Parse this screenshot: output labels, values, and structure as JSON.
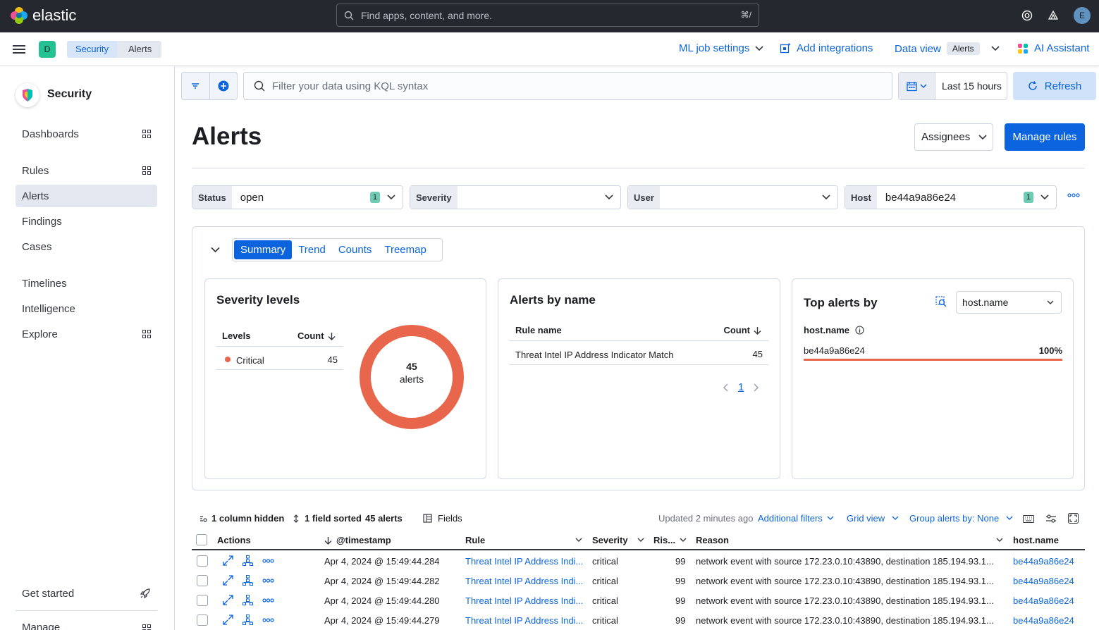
{
  "header": {
    "app_name": "elastic",
    "search_placeholder": "Find apps, content, and more.",
    "search_shortcut": "⌘/",
    "user_initial": "E"
  },
  "subheader": {
    "space_initial": "D",
    "breadcrumbs": [
      "Security",
      "Alerts"
    ],
    "ml_job_settings": "ML job settings",
    "add_integrations": "Add integrations",
    "data_view_label": "Data view",
    "data_view_value": "Alerts",
    "ai_assistant": "AI Assistant"
  },
  "sidebar": {
    "title": "Security",
    "items": [
      {
        "label": "Dashboards"
      },
      {
        "label": "Rules"
      },
      {
        "label": "Alerts"
      },
      {
        "label": "Findings"
      },
      {
        "label": "Cases"
      },
      {
        "label": "Timelines"
      },
      {
        "label": "Intelligence"
      },
      {
        "label": "Explore"
      }
    ],
    "get_started": "Get started",
    "manage": "Manage"
  },
  "querybar": {
    "placeholder": "Filter your data using KQL syntax",
    "time_range": "Last 15 hours",
    "refresh": "Refresh"
  },
  "page": {
    "title": "Alerts",
    "assignees": "Assignees",
    "manage_rules": "Manage rules"
  },
  "filters": [
    {
      "label": "Status",
      "value": "open",
      "count": "1"
    },
    {
      "label": "Severity",
      "value": "",
      "count": ""
    },
    {
      "label": "User",
      "value": "",
      "count": ""
    },
    {
      "label": "Host",
      "value": "be44a9a86e24",
      "count": "1"
    }
  ],
  "summary": {
    "tabs": [
      "Summary",
      "Trend",
      "Counts",
      "Treemap"
    ],
    "severity": {
      "title": "Severity levels",
      "col_levels": "Levels",
      "col_count": "Count",
      "rows": [
        {
          "level": "Critical",
          "count": "45"
        }
      ],
      "total": "45",
      "total_label": "alerts",
      "color": "#e7664c"
    },
    "by_name": {
      "title": "Alerts by name",
      "col_rule": "Rule name",
      "col_count": "Count",
      "rows": [
        {
          "rule": "Threat Intel IP Address Indicator Match",
          "count": "45"
        }
      ],
      "page": "1"
    },
    "top_alerts": {
      "title": "Top alerts by",
      "field": "host.name",
      "field_label": "host.name",
      "rows": [
        {
          "value": "be44a9a86e24",
          "pct_label": "100%",
          "fraction": 1.0
        }
      ]
    }
  },
  "table_toolbar": {
    "columns_hidden": "1 column hidden",
    "fields_sorted": "1 field sorted",
    "alerts_count": "45 alerts",
    "fields": "Fields",
    "updated": "Updated 2 minutes ago",
    "additional_filters": "Additional filters",
    "grid_view": "Grid view",
    "group_by": "Group alerts by: None"
  },
  "table": {
    "columns": {
      "actions": "Actions",
      "timestamp": "@timestamp",
      "rule": "Rule",
      "severity": "Severity",
      "risk": "Ris...",
      "reason": "Reason",
      "host": "host.name"
    },
    "rows": [
      {
        "timestamp": "Apr 4, 2024 @ 15:49:44.284",
        "rule": "Threat Intel IP Address Indi...",
        "severity": "critical",
        "risk": "99",
        "reason": "network event with source 172.23.0.10:43890, destination 185.194.93.1...",
        "host": "be44a9a86e24"
      },
      {
        "timestamp": "Apr 4, 2024 @ 15:49:44.282",
        "rule": "Threat Intel IP Address Indi...",
        "severity": "critical",
        "risk": "99",
        "reason": "network event with source 172.23.0.10:43890, destination 185.194.93.1...",
        "host": "be44a9a86e24"
      },
      {
        "timestamp": "Apr 4, 2024 @ 15:49:44.280",
        "rule": "Threat Intel IP Address Indi...",
        "severity": "critical",
        "risk": "99",
        "reason": "network event with source 172.23.0.10:43890, destination 185.194.93.1...",
        "host": "be44a9a86e24"
      },
      {
        "timestamp": "Apr 4, 2024 @ 15:49:44.279",
        "rule": "Threat Intel IP Address Indi...",
        "severity": "critical",
        "risk": "99",
        "reason": "network event with source 172.23.0.10:43890, destination 185.194.93.1...",
        "host": "be44a9a86e24"
      }
    ]
  }
}
